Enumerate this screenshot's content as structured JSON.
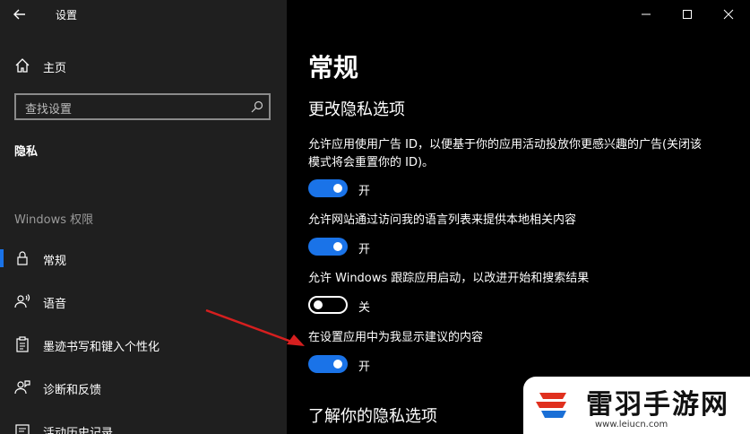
{
  "window": {
    "title": "设置"
  },
  "sidebar": {
    "home_label": "主页",
    "search_placeholder": "查找设置",
    "current_label": "隐私",
    "section_label": "Windows 权限",
    "items": [
      {
        "label": "常规",
        "icon": "lock-icon",
        "active": true
      },
      {
        "label": "语音",
        "icon": "speech-person-icon"
      },
      {
        "label": "墨迹书写和键入个性化",
        "icon": "clipboard-icon"
      },
      {
        "label": "诊断和反馈",
        "icon": "feedback-person-icon"
      },
      {
        "label": "活动历史记录",
        "icon": "history-icon"
      }
    ]
  },
  "main": {
    "title": "常规",
    "subtitle": "更改隐私选项",
    "options": [
      {
        "text": "允许应用使用广告 ID，以便基于你的应用活动投放你更感兴趣的广告(关闭该模式将会重置你的 ID)。",
        "state": "开",
        "on": true
      },
      {
        "text": "允许网站通过访问我的语言列表来提供本地相关内容",
        "state": "开",
        "on": true
      },
      {
        "text": "允许 Windows 跟踪应用启动，以改进开始和搜索结果",
        "state": "关",
        "on": false
      },
      {
        "text": "在设置应用中为我显示建议的内容",
        "state": "开",
        "on": true
      }
    ],
    "learn_more_heading": "了解你的隐私选项"
  },
  "watermark": {
    "brand": "雷羽手游网",
    "url": "www.leiucn.com"
  },
  "colors": {
    "accent": "#1a73e8",
    "sidebar_bg": "#1f1f1f",
    "main_bg": "#000000",
    "arrow": "#d61f1f"
  }
}
